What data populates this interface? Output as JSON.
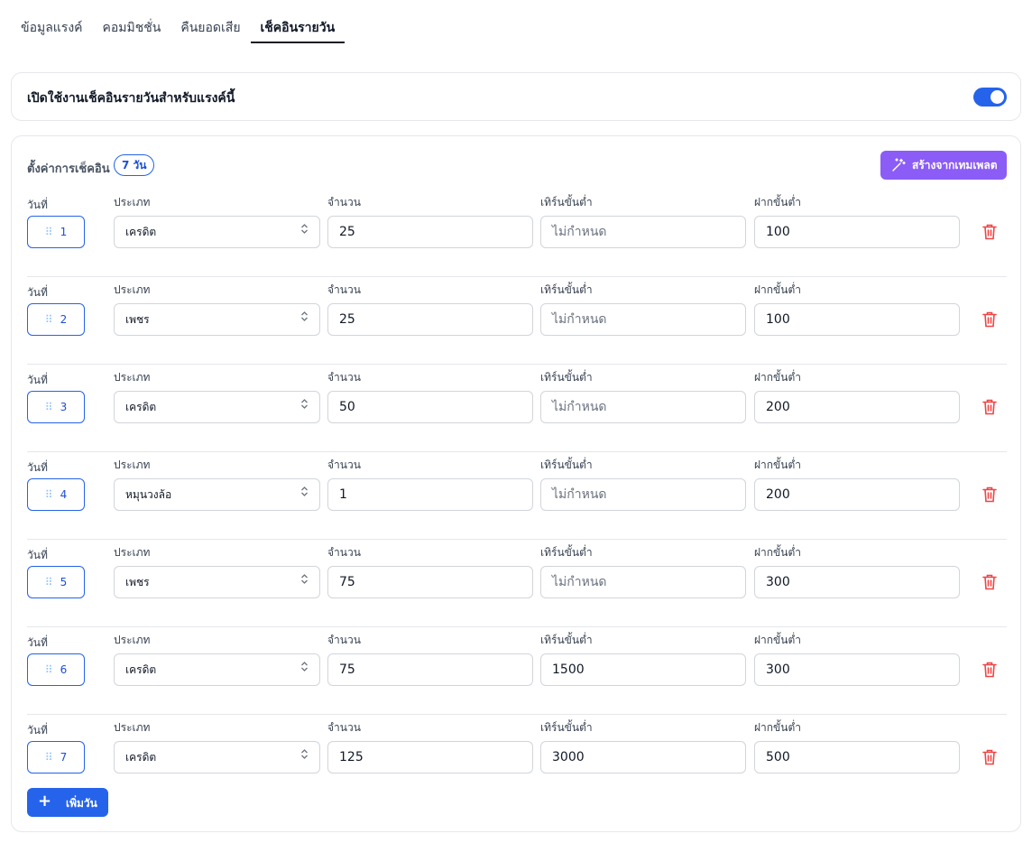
{
  "tabs": [
    {
      "label": "ข้อมูลแรงค์",
      "active": false
    },
    {
      "label": "คอมมิชชั่น",
      "active": false
    },
    {
      "label": "คืนยอดเสีย",
      "active": false
    },
    {
      "label": "เช็คอินรายวัน",
      "active": true
    }
  ],
  "toggle_card": {
    "label": "เปิดใช้งานเช็คอินรายวันสำหรับแรงค์นี้",
    "enabled": true
  },
  "settings": {
    "title": "ตั้งค่าการเช็คอิน",
    "days_badge": "7 วัน",
    "template_button": "สร้างจากเทมเพลต",
    "add_day_button": "เพิ่มวัน",
    "columns": {
      "day": "วันที่",
      "type": "ประเภท",
      "amount": "จำนวน",
      "min_turnover": "เทิร์นขั้นต่ำ",
      "min_deposit": "ฝากขั้นต่ำ"
    },
    "placeholder_turnover": "ไม่กำหนด",
    "rows": [
      {
        "day": "1",
        "type": "เครดิต",
        "amount": "25",
        "turnover": "",
        "deposit": "100"
      },
      {
        "day": "2",
        "type": "เพชร",
        "amount": "25",
        "turnover": "",
        "deposit": "100"
      },
      {
        "day": "3",
        "type": "เครดิต",
        "amount": "50",
        "turnover": "",
        "deposit": "200"
      },
      {
        "day": "4",
        "type": "หมุนวงล้อ",
        "amount": "1",
        "turnover": "",
        "deposit": "200"
      },
      {
        "day": "5",
        "type": "เพชร",
        "amount": "75",
        "turnover": "",
        "deposit": "300"
      },
      {
        "day": "6",
        "type": "เครดิต",
        "amount": "75",
        "turnover": "1500",
        "deposit": "300"
      },
      {
        "day": "7",
        "type": "เครดิต",
        "amount": "125",
        "turnover": "3000",
        "deposit": "500"
      }
    ]
  },
  "colors": {
    "primary": "#2563eb",
    "template": "#8b5cf6",
    "danger": "#ef4444"
  },
  "icons": {
    "template": "magic-wand-icon",
    "delete": "trash-icon",
    "drag": "grip-icon",
    "add": "plus-icon",
    "select": "chevron-up-down-icon"
  }
}
